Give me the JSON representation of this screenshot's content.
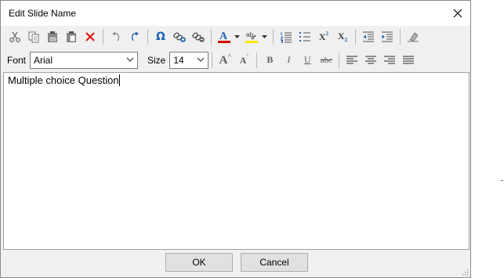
{
  "window": {
    "title": "Edit Slide Name"
  },
  "toolbar": {
    "buttons_row1": [
      "cut-icon",
      "copy-icon",
      "paste-icon",
      "paste-special-icon",
      "delete-icon",
      "undo-icon",
      "redo-icon",
      "special-character-icon",
      "insert-link-icon",
      "remove-link-icon",
      "font-color-icon",
      "highlight-color-icon",
      "numbered-list-icon",
      "bulleted-list-icon",
      "superscript-icon",
      "subscript-icon",
      "decrease-indent-icon",
      "increase-indent-icon",
      "clear-formatting-icon"
    ],
    "font_label": "Font",
    "font_value": "Arial",
    "size_label": "Size",
    "size_value": "14",
    "bold_label": "B",
    "italic_label": "I",
    "underline_label": "U",
    "strike_label": "abc",
    "superscript_label": "X",
    "subscript_label": "X",
    "omega_label": "Ω",
    "font_color_label": "A",
    "highlight_label": "ab",
    "grow_font_label": "A",
    "shrink_font_label": "A"
  },
  "editor": {
    "text": "Multiple choice Question"
  },
  "footer": {
    "ok_label": "OK",
    "cancel_label": "Cancel"
  },
  "colors": {
    "font_color": "#d40000",
    "highlight_color": "#ffe600",
    "accent_blue": "#1e64b4",
    "delete_red": "#e01010"
  }
}
